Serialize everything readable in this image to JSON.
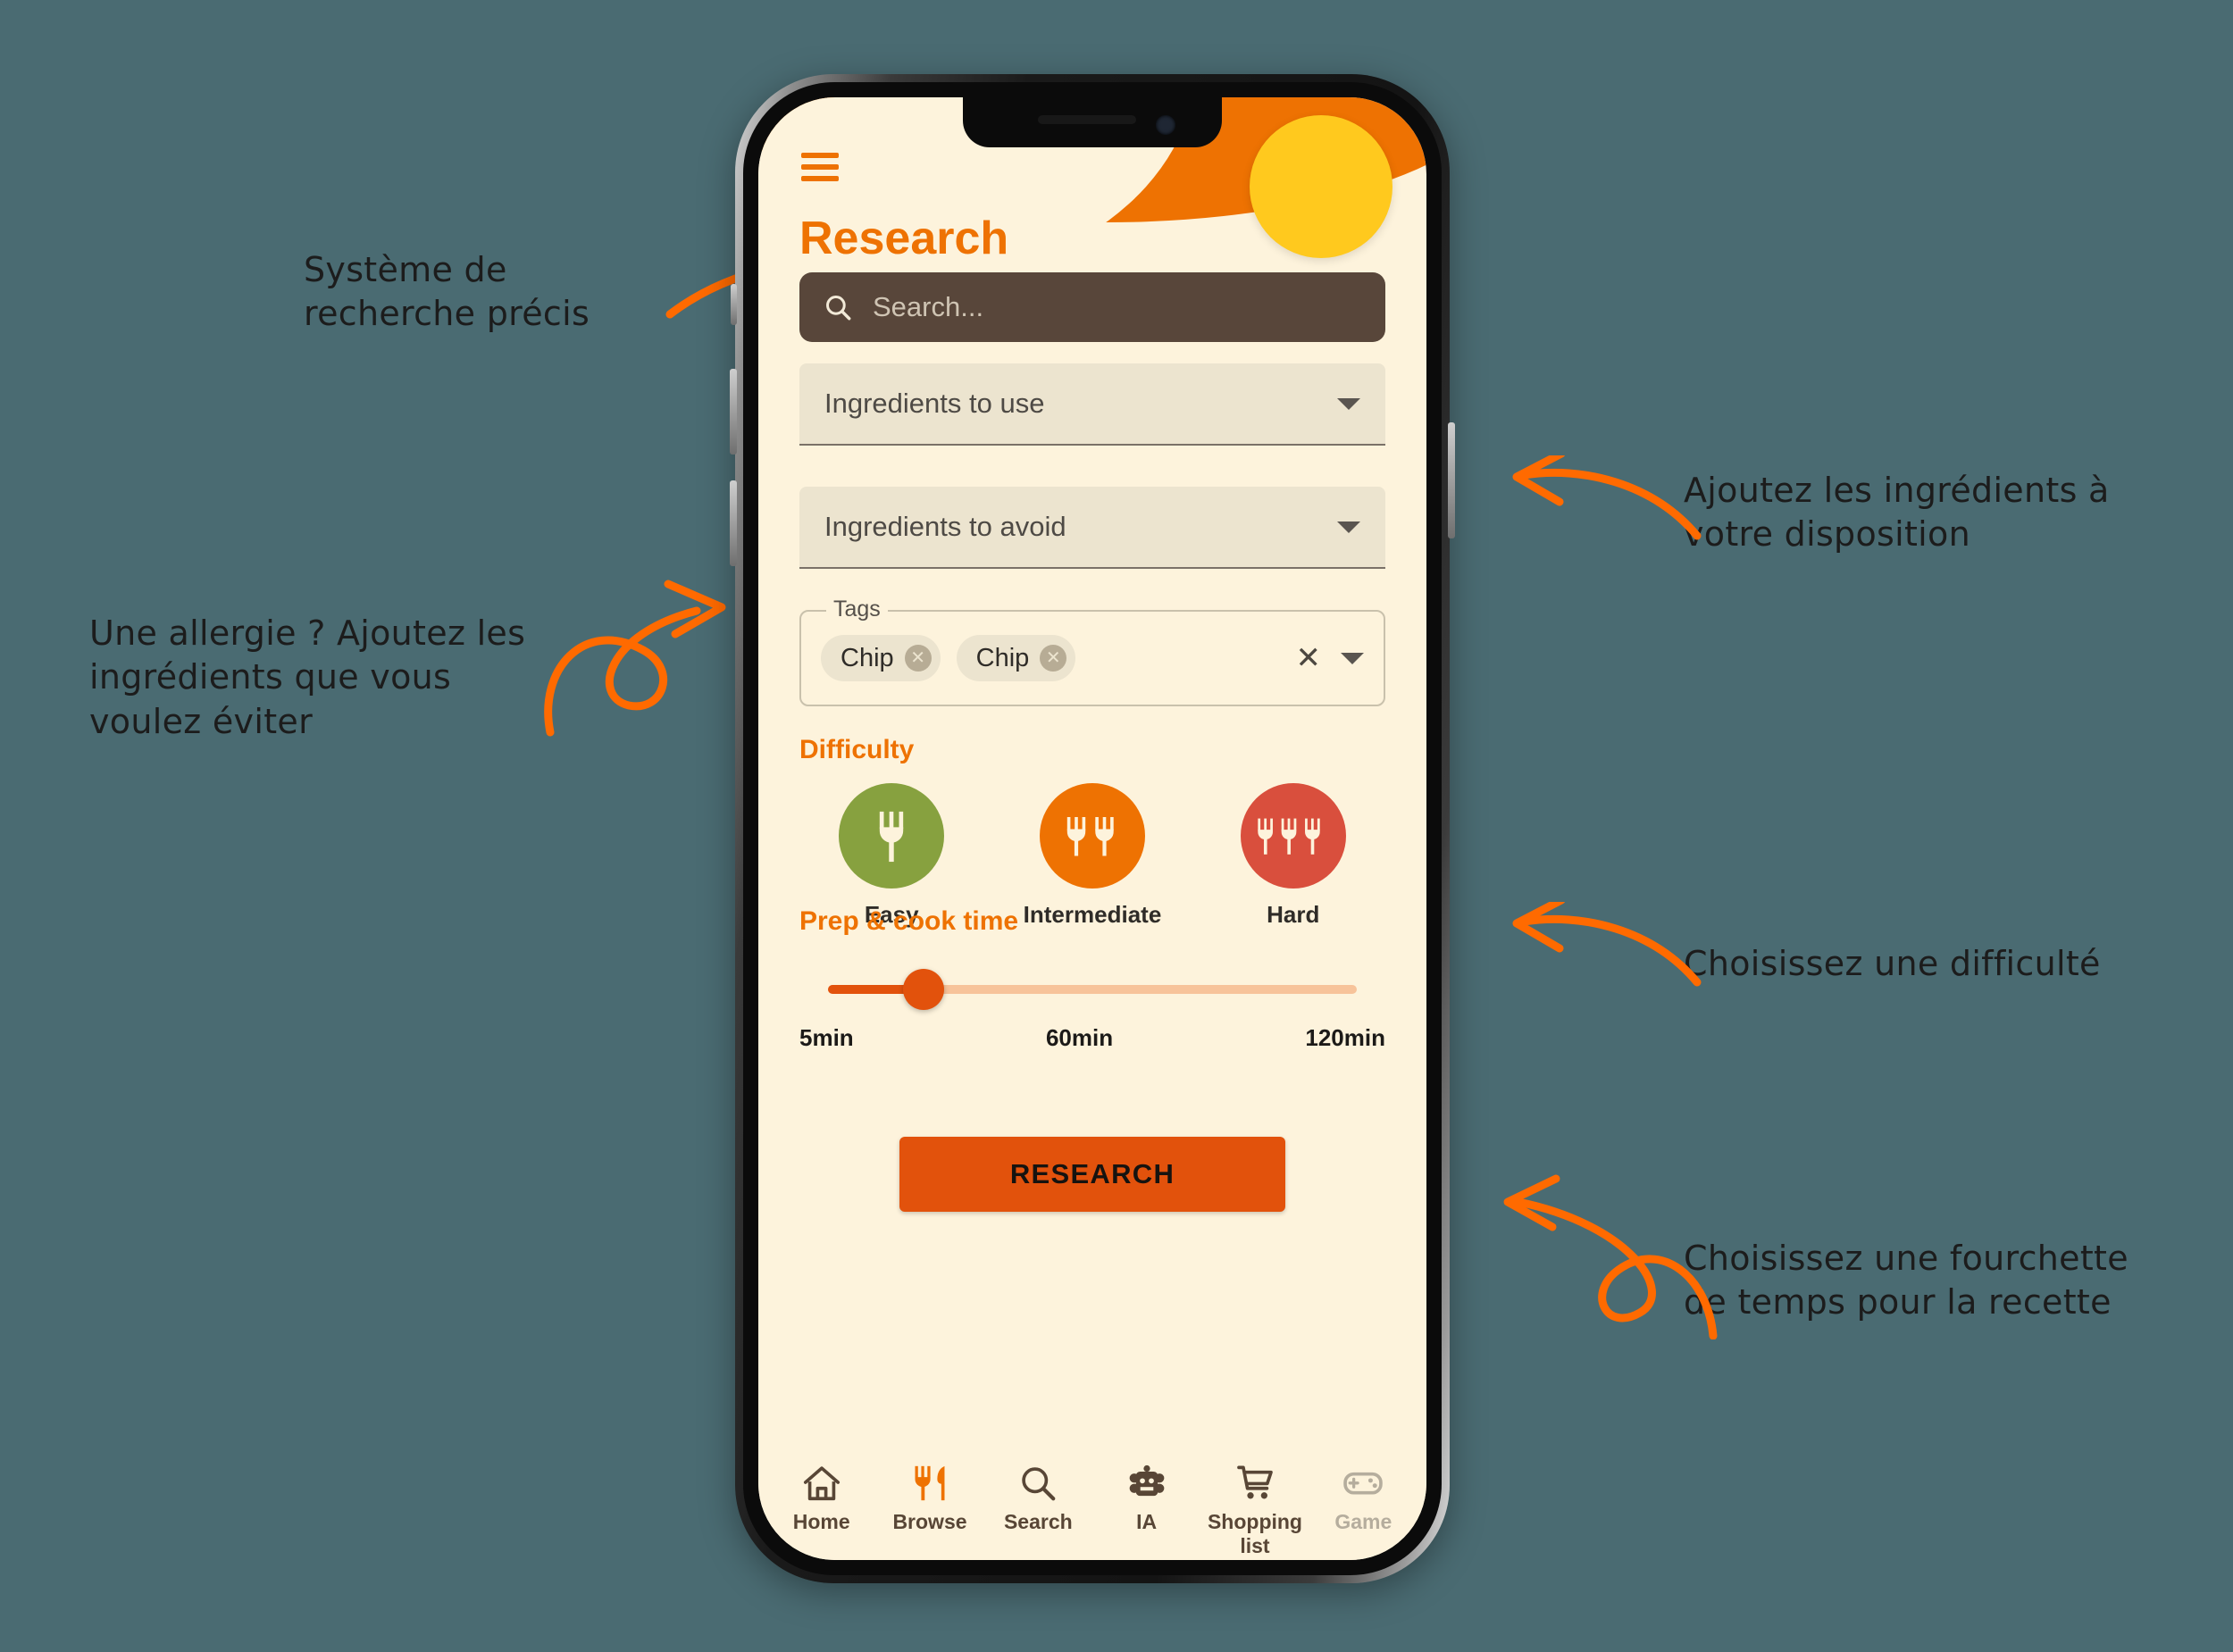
{
  "page": {
    "background_color": "#4a6b72"
  },
  "annotations": [
    {
      "id": "anno-search",
      "text": "Système de\nrecherche précis"
    },
    {
      "id": "anno-allergy",
      "text": "Une allergie ? Ajoutez les\ningrédients que vous\nvoulez éviter"
    },
    {
      "id": "anno-add",
      "text": "Ajoutez les ingrédients à\nvotre disposition"
    },
    {
      "id": "anno-diff",
      "text": "Choisissez une difficulté"
    },
    {
      "id": "anno-time",
      "text": "Choisissez une fourchette\nde temps pour la recette"
    }
  ],
  "app": {
    "title": "Research",
    "menu_icon": "hamburger-icon",
    "accent_color": "#ee7202",
    "screen_bg": "#fdf3dc",
    "yellow_circle_color": "#ffc91e",
    "search": {
      "placeholder": "Search...",
      "value": "",
      "icon": "search-icon",
      "bg_color": "#58463a"
    },
    "selects": [
      {
        "name": "ingredients-to-use",
        "label": "Ingredients to use",
        "icon": "chevron-down-icon"
      },
      {
        "name": "ingredients-to-avoid",
        "label": "Ingredients to avoid",
        "icon": "chevron-down-icon"
      }
    ],
    "tags": {
      "legend": "Tags",
      "chips": [
        {
          "label": "Chip",
          "remove_icon": "close-circle-icon"
        },
        {
          "label": "Chip",
          "remove_icon": "close-circle-icon"
        }
      ],
      "clear_icon": "close-icon",
      "clear_label": "✕",
      "dropdown_icon": "chevron-down-icon"
    },
    "difficulty": {
      "title": "Difficulty",
      "options": [
        {
          "label": "Easy",
          "forks": 1,
          "color": "#87a13f",
          "icon": "fork-icon"
        },
        {
          "label": "Intermediate",
          "forks": 2,
          "color": "#ee7202",
          "icon": "fork-icon"
        },
        {
          "label": "Hard",
          "forks": 3,
          "color": "#d94f3d",
          "icon": "fork-icon"
        }
      ]
    },
    "prep_time": {
      "title": "Prep & cook time",
      "min_label": "5min",
      "mid_label": "60min",
      "max_label": "120min",
      "min": 5,
      "max": 120,
      "value": 25,
      "thumb_position_pct": 18,
      "track_color": "#f7c39a",
      "fill_color": "#e2520c"
    },
    "submit": {
      "label": "RESEARCH",
      "color": "#e2520c"
    },
    "bottom_nav": [
      {
        "name": "home",
        "label": "Home",
        "icon": "home-icon",
        "state": "normal"
      },
      {
        "name": "browse",
        "label": "Browse",
        "icon": "cutlery-icon",
        "state": "accent"
      },
      {
        "name": "search",
        "label": "Search",
        "icon": "search-icon",
        "state": "normal"
      },
      {
        "name": "ia",
        "label": "IA",
        "icon": "robot-icon",
        "state": "normal"
      },
      {
        "name": "shopping-list",
        "label": "Shopping list",
        "icon": "cart-icon",
        "state": "normal"
      },
      {
        "name": "game",
        "label": "Game",
        "icon": "gamepad-icon",
        "state": "disabled"
      }
    ]
  }
}
